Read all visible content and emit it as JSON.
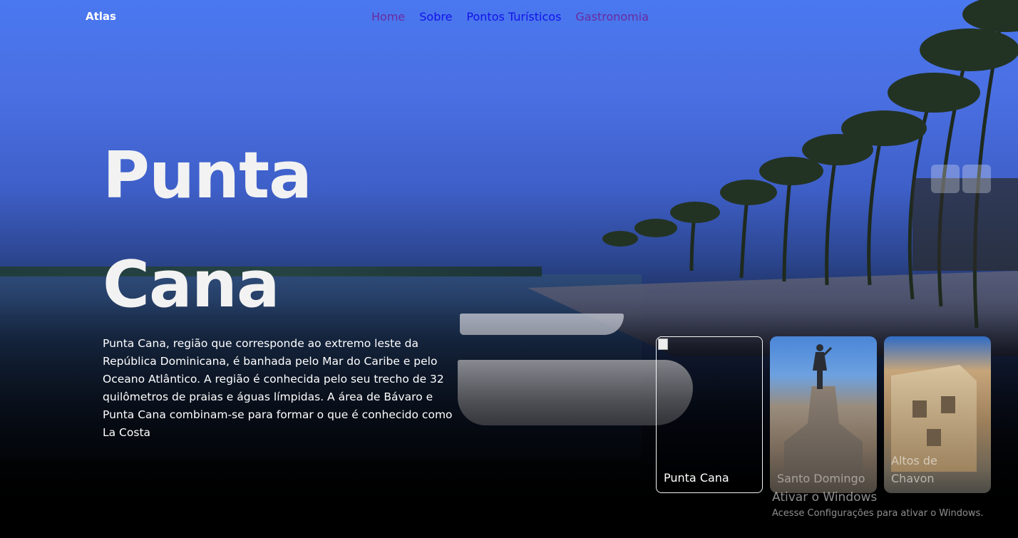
{
  "header": {
    "logo": "Atlas",
    "nav": [
      {
        "label": "Home",
        "state": "visited"
      },
      {
        "label": "Sobre",
        "state": "link"
      },
      {
        "label": "Pontos Turísticos",
        "state": "link"
      },
      {
        "label": "Gastronomia",
        "state": "visited"
      }
    ]
  },
  "hero": {
    "title_line1": "Punta",
    "title_line2": "Cana",
    "description": "Punta Cana, região que corresponde ao extremo leste da República Dominicana, é banhada pelo Mar do Caribe e pelo Oceano Atlântico. A região é conhecida pelo seu trecho de 32 quilômetros de praias e águas límpidas. A área de Bávaro e Punta Cana combinam-se para formar o que é conhecido como La Costa"
  },
  "slider": {
    "prev_icon": "arrow-left-icon",
    "next_icon": "arrow-right-icon",
    "cards": [
      {
        "label": "Punta Cana",
        "image": "broken-image-icon"
      },
      {
        "label": "Santo Domingo"
      },
      {
        "label": "Altos de Chavon"
      }
    ]
  },
  "windows_watermark": {
    "title": "Ativar o Windows",
    "subtitle": "Acesse Configurações para ativar o Windows."
  },
  "colors": {
    "nav_visited": "#6a2b9e",
    "nav_link": "#1212e8",
    "sky_top": "#4a78f0"
  }
}
